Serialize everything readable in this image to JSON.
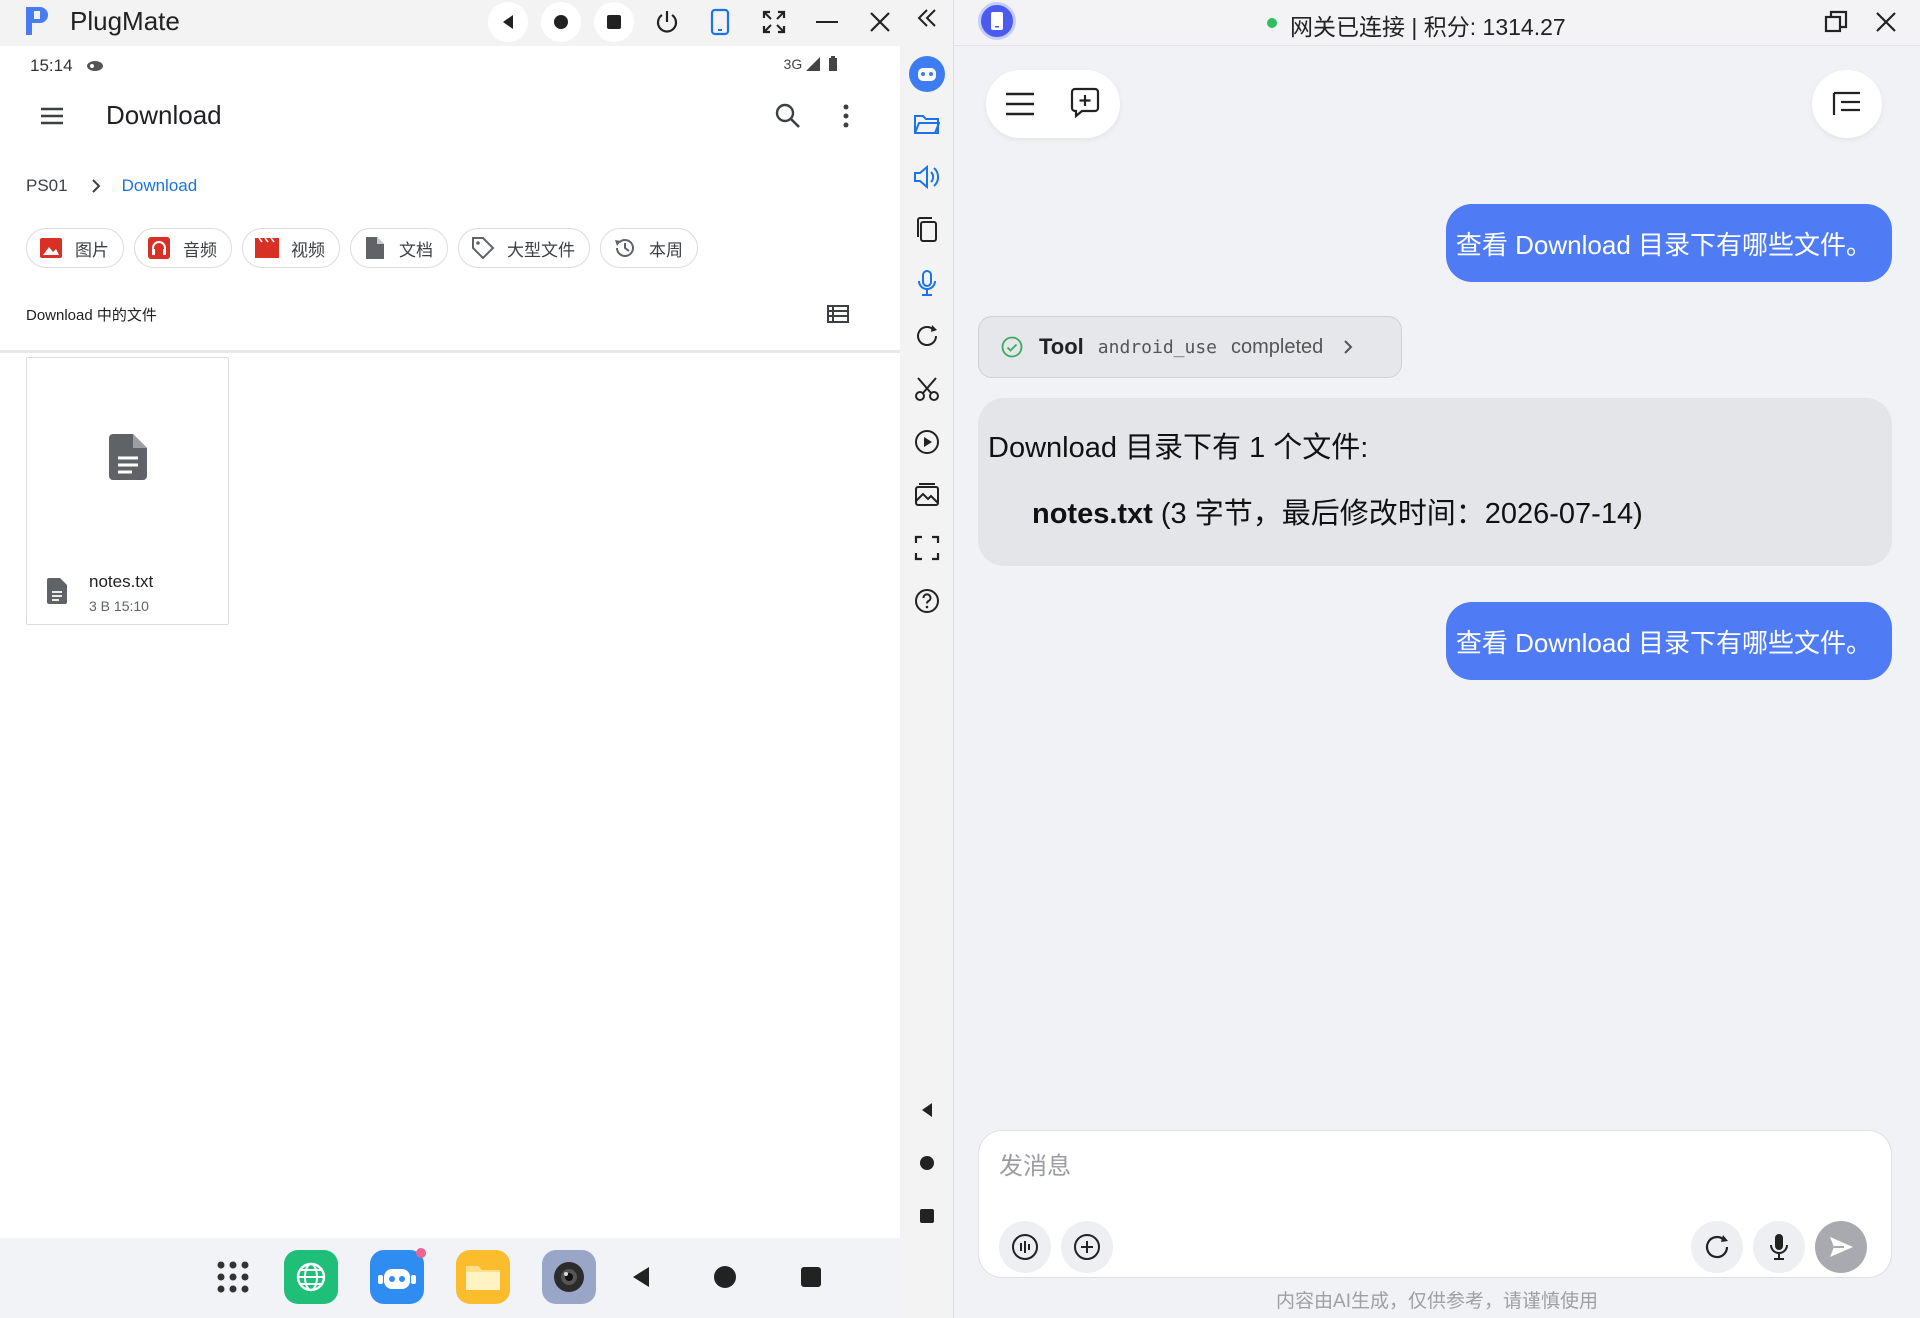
{
  "window": {
    "app_title": "PlugMate"
  },
  "phone": {
    "status": {
      "time": "15:14",
      "network": "3G"
    },
    "toolbar": {
      "title": "Download"
    },
    "breadcrumb": {
      "root": "PS01",
      "current": "Download"
    },
    "chips": [
      {
        "label": "图片",
        "icon": "image-icon",
        "color": "#d93025"
      },
      {
        "label": "音频",
        "icon": "headphones-icon",
        "color": "#d93025"
      },
      {
        "label": "视频",
        "icon": "movie-icon",
        "color": "#d93025"
      },
      {
        "label": "文档",
        "icon": "document-icon",
        "color": "#5f6368"
      },
      {
        "label": "大型文件",
        "icon": "tag-icon",
        "color": "#5f6368"
      },
      {
        "label": "本周",
        "icon": "history-icon",
        "color": "#5f6368"
      }
    ],
    "files_header": "Download 中的文件",
    "files": [
      {
        "name": "notes.txt",
        "meta": "3 B 15:10"
      }
    ]
  },
  "chat": {
    "status_text": "网关已连接 | 积分: 1314.27",
    "messages": {
      "user_1": "查看 Download 目录下有哪些文件。",
      "tool": {
        "label": "Tool",
        "name": "android_use",
        "status": "completed"
      },
      "assistant_line1": "Download 目录下有 1 个文件:",
      "assistant_file": "notes.txt",
      "assistant_detail": " (3 字节，最后修改时间：2026-07-14)",
      "user_2": "查看 Download 目录下有哪些文件。"
    },
    "composer": {
      "placeholder": "发消息"
    },
    "disclaimer": "内容由AI生成，仅供参考，请谨慎使用"
  },
  "colors": {
    "accent": "#4f7cf5",
    "link": "#1a73e8",
    "connected": "#2fbf5f"
  }
}
